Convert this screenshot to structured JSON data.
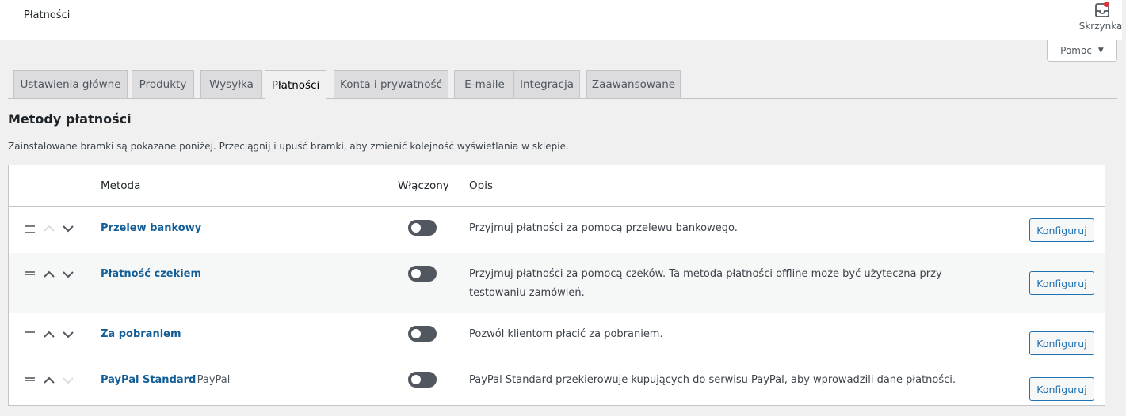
{
  "header": {
    "title": "Płatności",
    "inbox_label": "Skrzynka",
    "inbox_icon": "inbox-icon"
  },
  "help": {
    "label": "Pomoc"
  },
  "tabs": [
    {
      "label": "Ustawienia główne",
      "active": false
    },
    {
      "label": "Produkty",
      "active": false
    },
    {
      "label": "Wysyłka",
      "active": false
    },
    {
      "label": "Płatności",
      "active": true
    },
    {
      "label": "Konta i prywatność",
      "active": false
    },
    {
      "label": "E-maile",
      "active": false
    },
    {
      "label": "Integracja",
      "active": false
    },
    {
      "label": "Zaawansowane",
      "active": false
    }
  ],
  "section": {
    "title": "Metody płatności",
    "description": "Zainstalowane bramki są pokazane poniżej. Przeciągnij i upuść bramki, aby zmienić kolejność wyświetlania w sklepie."
  },
  "table": {
    "headers": {
      "method": "Metoda",
      "enabled": "Włączony",
      "description": "Opis"
    },
    "rows": [
      {
        "name": "Przelew bankowy",
        "suffix": "",
        "enabled": false,
        "description": "Przyjmuj płatności za pomocą przelewu bankowego.",
        "action": "Konfiguruj",
        "up_disabled": true,
        "down_disabled": false
      },
      {
        "name": "Płatność czekiem",
        "suffix": "",
        "enabled": false,
        "description": "Przyjmuj płatności za pomocą czeków. Ta metoda płatności offline może być użyteczna przy testowaniu zamówień.",
        "action": "Konfiguruj",
        "up_disabled": false,
        "down_disabled": false
      },
      {
        "name": "Za pobraniem",
        "suffix": "",
        "enabled": false,
        "description": "Pozwól klientom płacić za pobraniem.",
        "action": "Konfiguruj",
        "up_disabled": false,
        "down_disabled": false
      },
      {
        "name": "PayPal Standard",
        "suffix": "– PayPal",
        "enabled": false,
        "description": "PayPal Standard przekierowuje kupujących do serwisu PayPal, aby wprowadzili dane płatności.",
        "action": "Konfiguruj",
        "up_disabled": false,
        "down_disabled": true
      }
    ]
  },
  "colors": {
    "link": "#135e96",
    "button_accent": "#2271b1",
    "notification_dot": "#d63638",
    "toggle_off": "#50575e"
  }
}
